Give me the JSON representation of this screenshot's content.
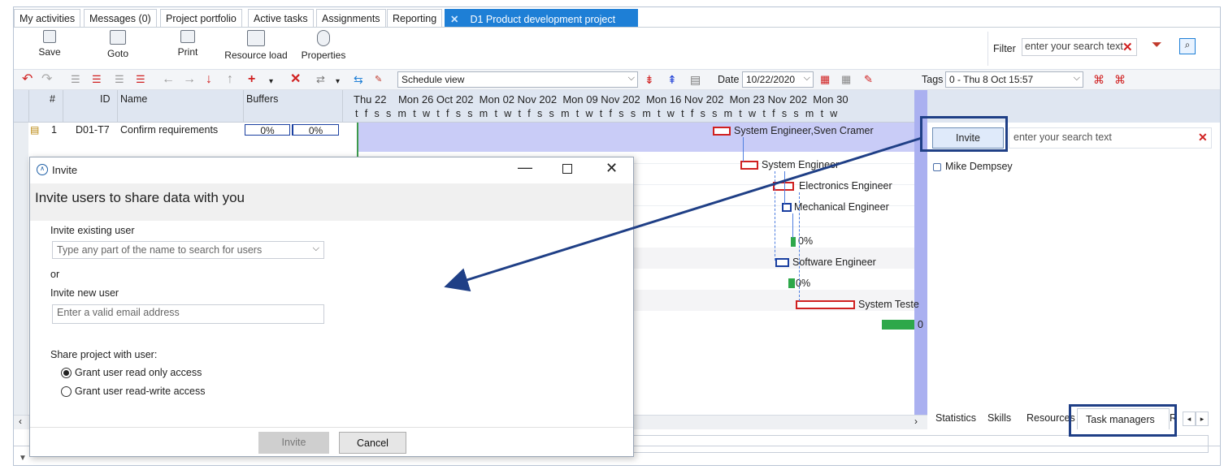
{
  "tabs": [
    "My activities",
    "Messages (0)",
    "Project portfolio",
    "Active tasks",
    "Assignments",
    "Reporting"
  ],
  "active_tab": "D1 Product development project",
  "ribbon": {
    "save": "Save",
    "goto": "Goto",
    "print": "Print",
    "resource_load": "Resource load",
    "properties": "Properties"
  },
  "filter": {
    "label": "Filter",
    "placeholder": "enter your search text"
  },
  "toolbar": {
    "view": "Schedule view",
    "date_label": "Date",
    "date_value": "10/22/2020",
    "tags_label": "Tags",
    "tags_value": "0 - Thu 8 Oct 15:57"
  },
  "grid": {
    "columns": [
      "#",
      "ID",
      "Name",
      "Buffers"
    ],
    "row": {
      "num": "1",
      "id": "D01-T7",
      "name": "Confirm requirements",
      "buffer1": "0%",
      "buffer2": "0%"
    }
  },
  "timeline": {
    "dates": [
      "Thu 22",
      "Mon 26 Oct 202",
      "Mon 02 Nov 202",
      "Mon 09 Nov 202",
      "Mon 16 Nov 202",
      "Mon 23 Nov 202",
      "Mon 30"
    ],
    "days": "t f s s m t w t f s s m t w t f s s m t w t f s s m t w t f s s m t w t f s s m t w"
  },
  "gantt_labels": {
    "l1": "System Engineer,Sven Cramer",
    "l2": "System Engineer",
    "l3": "Electronics Engineer",
    "l4": "Mechanical Engineer",
    "l5": "0%",
    "l6": "Software Engineer",
    "l7": "0%",
    "l8": "System Teste",
    "l9": "0"
  },
  "right_panel": {
    "invite_button": "Invite",
    "search_placeholder": "enter your search text",
    "user": "Mike Dempsey",
    "tabs": [
      "Statistics",
      "Skills",
      "Resources",
      "Task managers",
      "R"
    ]
  },
  "dialog": {
    "title": "Invite",
    "heading": "Invite users to share data with you",
    "existing_label": "Invite existing user",
    "existing_placeholder": "Type any part of the name to search for users",
    "or": "or",
    "new_label": "Invite new user",
    "email_placeholder": "Enter a valid email address",
    "share_label": "Share project with user:",
    "opt_readonly": "Grant user read only access",
    "opt_readwrite": "Grant user read-write access",
    "invite_button": "Invite",
    "cancel_button": "Cancel"
  },
  "colors": {
    "accent": "#1e7fd6",
    "highlight_box": "#1f3f86",
    "gantt_selection": "#c9ccf7",
    "task_red": "#d02020",
    "task_green": "#2ea84a"
  }
}
